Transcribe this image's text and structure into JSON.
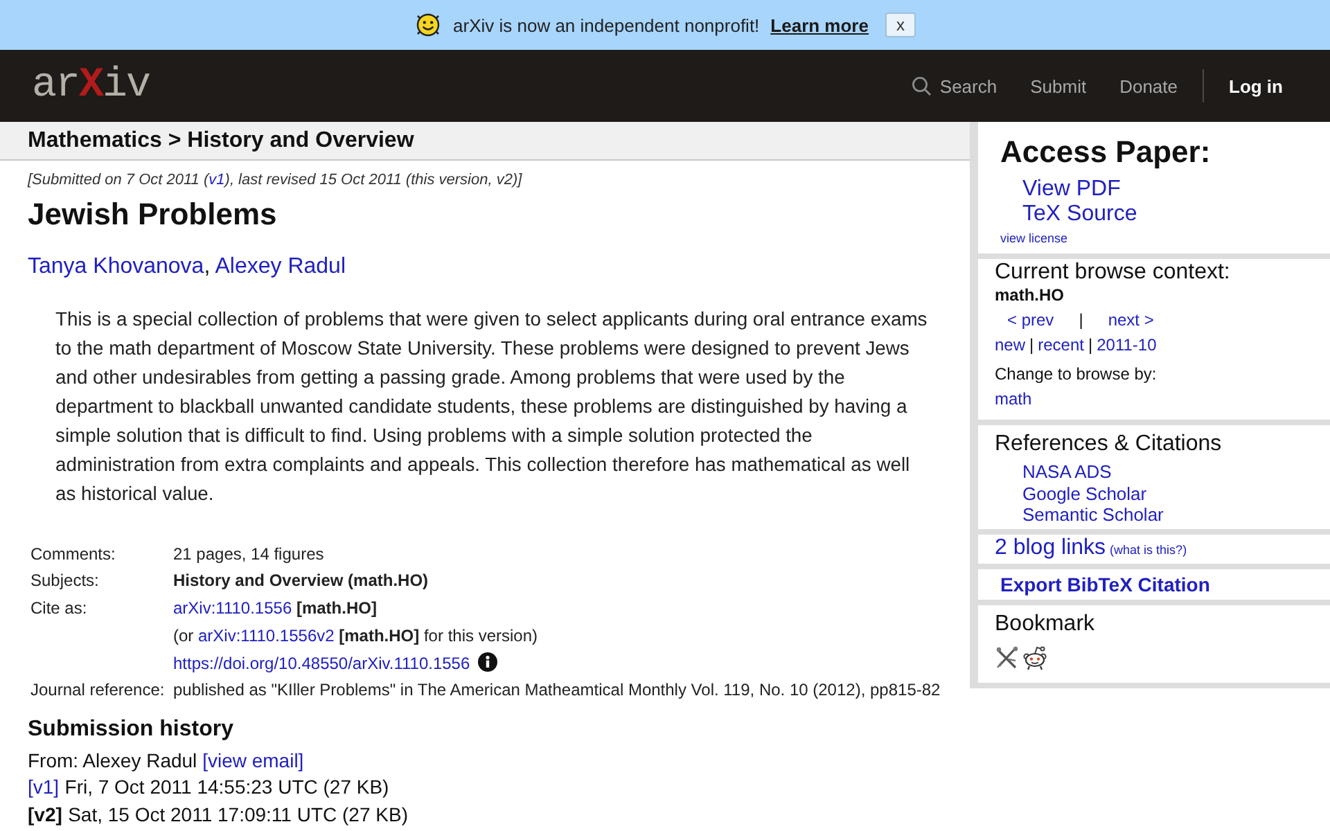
{
  "banner": {
    "message": "arXiv is now an independent nonprofit!",
    "link": "Learn more",
    "close": "x"
  },
  "header": {
    "logo": {
      "left": "ar",
      "mark": "X",
      "right": "iv"
    },
    "nav": [
      {
        "kind": "search",
        "label": "Search"
      },
      {
        "kind": "link",
        "label": "Submit"
      },
      {
        "kind": "link",
        "label": "Donate"
      },
      {
        "kind": "login",
        "label": "Log in"
      }
    ]
  },
  "breadcrumb": "Mathematics > History and Overview",
  "dateline": [
    {
      "kind": "text",
      "text": "[Submitted on 7 Oct 2011 ("
    },
    {
      "kind": "link",
      "text": "v1"
    },
    {
      "kind": "text",
      "text": "), last revised 15 Oct 2011 (this version, v2)]"
    }
  ],
  "title": "Jewish Problems",
  "authors": [
    {
      "name": "Tanya Khovanova",
      "separator": ","
    },
    {
      "name": "Alexey Radul"
    }
  ],
  "abstract": "This is a special collection of problems that were given to select applicants during oral entrance exams to the math department of Moscow State University. These problems were designed to prevent Jews and other undesirables from getting a passing grade. Among problems that were used by the department to blackball unwanted candidate students, these problems are distinguished by having a simple solution that is difficult to find. Using problems with a simple solution protected the administration from extra complaints and appeals. This collection therefore has mathematical as well as historical value.",
  "metadata": [
    {
      "label": "Comments:",
      "lines": [
        [
          {
            "kind": "text",
            "text": "21 pages, 14 figures"
          }
        ]
      ]
    },
    {
      "label": "Subjects:",
      "lines": [
        [
          {
            "kind": "bold",
            "text": "History and Overview (math.HO)"
          }
        ]
      ]
    },
    {
      "label": "Cite as:",
      "lines": [
        [
          {
            "kind": "link",
            "text": "arXiv:1110.1556"
          },
          {
            "kind": "bold",
            "text": " [math.HO]"
          }
        ],
        [
          {
            "kind": "text",
            "text": "(or "
          },
          {
            "kind": "link",
            "text": "arXiv:1110.1556v2"
          },
          {
            "kind": "bold",
            "text": " [math.HO]"
          },
          {
            "kind": "text",
            "text": " for this version)"
          }
        ],
        [
          {
            "kind": "link",
            "text": "https://doi.org/10.48550/arXiv.1110.1556"
          },
          {
            "kind": "info"
          }
        ]
      ]
    },
    {
      "label": "Journal reference:",
      "lines": [
        [
          {
            "kind": "text",
            "text": "published as \"KIller Problems\" in The American Matheamtical Monthly Vol. 119, No. 10 (2012), pp815-82"
          }
        ]
      ]
    }
  ],
  "submission_history": {
    "title": "Submission history",
    "from": [
      {
        "kind": "text",
        "text": "From: Alexey Radul "
      },
      {
        "kind": "link",
        "text": "[view email]"
      }
    ],
    "versions": [
      {
        "label": "[v1]",
        "text": "Fri, 7 Oct 2011 14:55:23 UTC (27 KB)",
        "selected": false
      },
      {
        "label": "[v2]",
        "text": "Sat, 15 Oct 2011 17:09:11 UTC (27 KB)",
        "selected": true
      }
    ]
  },
  "sidebar": [
    {
      "kind": "access",
      "title": "Access Paper:",
      "links": [
        "View PDF",
        "TeX Source"
      ],
      "license": "view license"
    },
    {
      "kind": "browse",
      "title": "Current browse context:",
      "context": "math.HO",
      "prev_next": [
        {
          "kind": "link",
          "text": "< prev"
        },
        {
          "kind": "sep",
          "text": "|"
        },
        {
          "kind": "link",
          "text": "next >"
        }
      ],
      "lists": [
        {
          "kind": "link",
          "text": "new"
        },
        {
          "kind": "sep",
          "text": "|"
        },
        {
          "kind": "link",
          "text": "recent"
        },
        {
          "kind": "sep",
          "text": "|"
        },
        {
          "kind": "link",
          "text": "2011-10"
        }
      ],
      "change_label": "Change to browse by:",
      "change_links": [
        "math"
      ]
    },
    {
      "kind": "refs",
      "title": "References & Citations",
      "links": [
        "NASA ADS",
        "Google Scholar",
        "Semantic Scholar"
      ]
    },
    {
      "kind": "blog",
      "link": "2 blog links",
      "help": "(what is this?)"
    },
    {
      "kind": "export",
      "link": "Export BibTeX Citation"
    },
    {
      "kind": "bookmark",
      "title": "Bookmark"
    }
  ]
}
